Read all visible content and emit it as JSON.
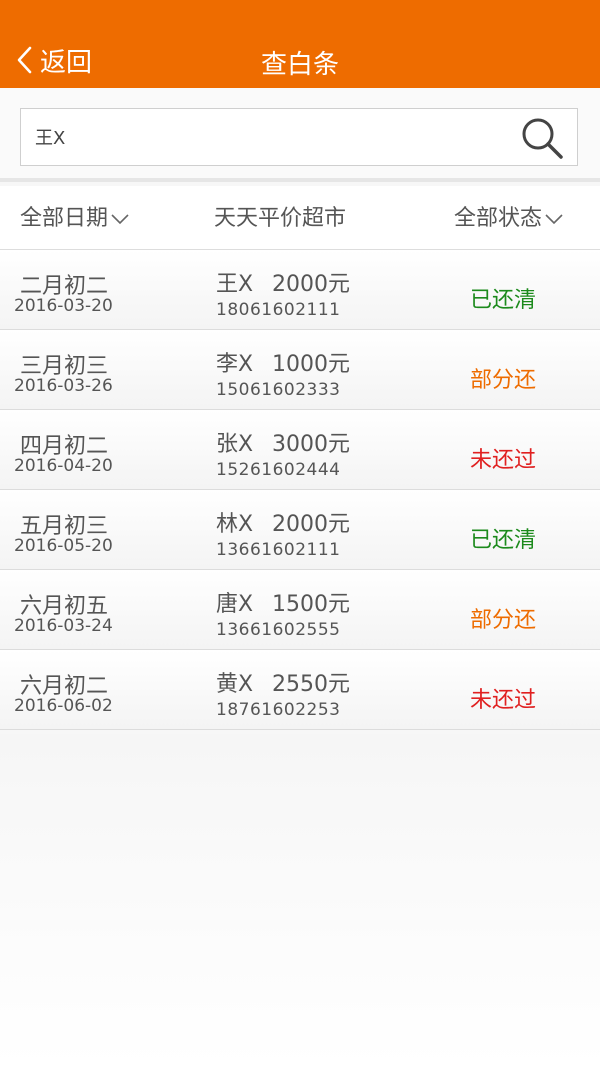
{
  "header": {
    "back_label": "返回",
    "title": "查白条",
    "background_color": "#ee6c00"
  },
  "search": {
    "value": "王X",
    "icon": "search-icon"
  },
  "filters": {
    "date_label": "全部日期",
    "shop_label": "天天平价超市",
    "status_label": "全部状态"
  },
  "records": [
    {
      "lunar": "二月初二",
      "date": "2016-03-20",
      "name": "王X",
      "amount": "2000元",
      "phone": "18061602111",
      "status": "已还清",
      "status_color": "#1c8a1c"
    },
    {
      "lunar": "三月初三",
      "date": "2016-03-26",
      "name": "李X",
      "amount": "1000元",
      "phone": "15061602333",
      "status": "部分还",
      "status_color": "#ee6c00"
    },
    {
      "lunar": "四月初二",
      "date": "2016-04-20",
      "name": "张X",
      "amount": "3000元",
      "phone": "15261602444",
      "status": "未还过",
      "status_color": "#e02020"
    },
    {
      "lunar": "五月初三",
      "date": "2016-05-20",
      "name": "林X",
      "amount": "2000元",
      "phone": "13661602111",
      "status": "已还清",
      "status_color": "#1c8a1c"
    },
    {
      "lunar": "六月初五",
      "date": "2016-03-24",
      "name": "唐X",
      "amount": "1500元",
      "phone": "13661602555",
      "status": "部分还",
      "status_color": "#ee6c00"
    },
    {
      "lunar": "六月初二",
      "date": "2016-06-02",
      "name": "黄X",
      "amount": "2550元",
      "phone": "18761602253",
      "status": "未还过",
      "status_color": "#e02020"
    }
  ]
}
